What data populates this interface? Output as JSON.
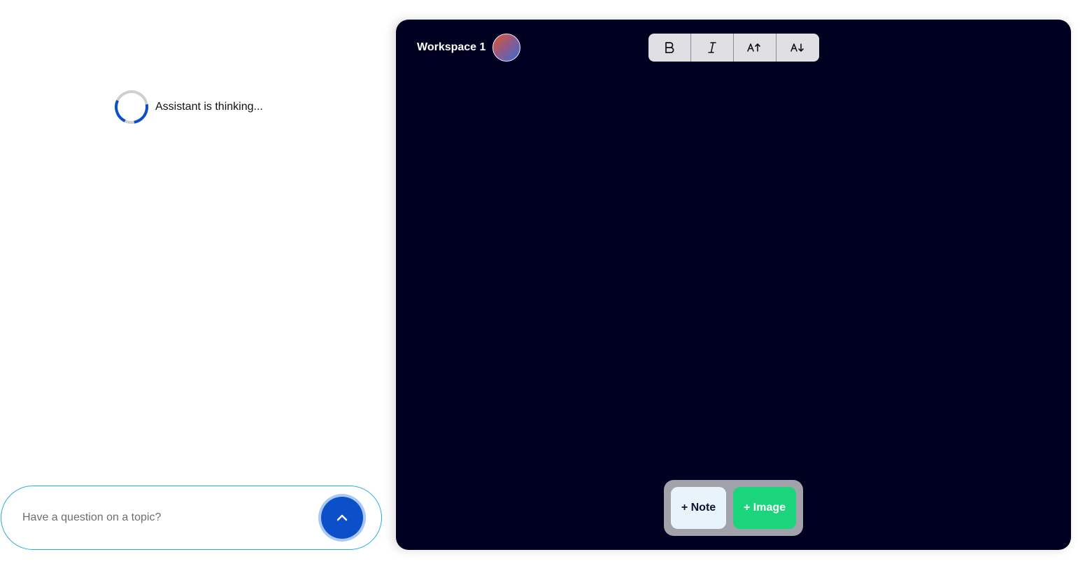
{
  "chat": {
    "status_text": "Assistant is thinking...",
    "input": {
      "value": "",
      "placeholder": "Have a question on a topic?"
    },
    "send_icon": "chevron-up-icon"
  },
  "workspace": {
    "title": "Workspace 1",
    "avatar_icon": "user-avatar-gradient",
    "toolbar": [
      {
        "name": "bold",
        "icon": "bold-icon"
      },
      {
        "name": "italic",
        "icon": "italic-icon"
      },
      {
        "name": "increase-font",
        "icon": "font-size-increase-icon"
      },
      {
        "name": "decrease-font",
        "icon": "font-size-decrease-icon"
      }
    ],
    "actions": {
      "note_label": "+ Note",
      "image_label": "+ Image"
    }
  },
  "colors": {
    "accent_blue": "#0b4fc9",
    "workspace_bg": "#000120",
    "image_button": "#1ad57b",
    "note_button": "#e8f3fc",
    "input_border": "#29a8e0"
  }
}
